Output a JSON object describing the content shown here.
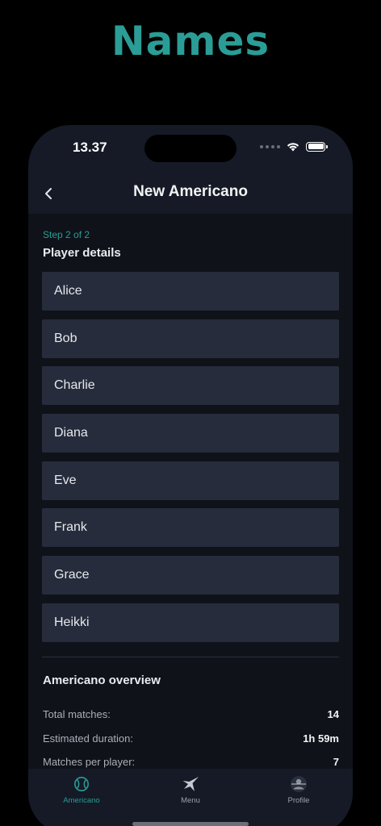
{
  "promo": {
    "title": "Names"
  },
  "status_bar": {
    "time": "13.37"
  },
  "nav": {
    "title": "New Americano"
  },
  "form": {
    "step_label": "Step 2 of 2",
    "section_title": "Player details",
    "players": [
      "Alice",
      "Bob",
      "Charlie",
      "Diana",
      "Eve",
      "Frank",
      "Grace",
      "Heikki"
    ]
  },
  "overview": {
    "title": "Americano overview",
    "rows": [
      {
        "label": "Total matches:",
        "value": "14"
      },
      {
        "label": "Estimated duration:",
        "value": "1h 59m"
      },
      {
        "label": "Matches per player:",
        "value": "7"
      }
    ]
  },
  "tabs": [
    {
      "label": "Americano",
      "icon": "tennis-ball-icon",
      "active": true
    },
    {
      "label": "Menu",
      "icon": "star-icon",
      "active": false
    },
    {
      "label": "Profile",
      "icon": "profile-icon",
      "active": false
    }
  ],
  "colors": {
    "accent": "#2a9d96",
    "background": "#0f1219",
    "input_background": "#272c3c",
    "chrome": "#151a26"
  }
}
